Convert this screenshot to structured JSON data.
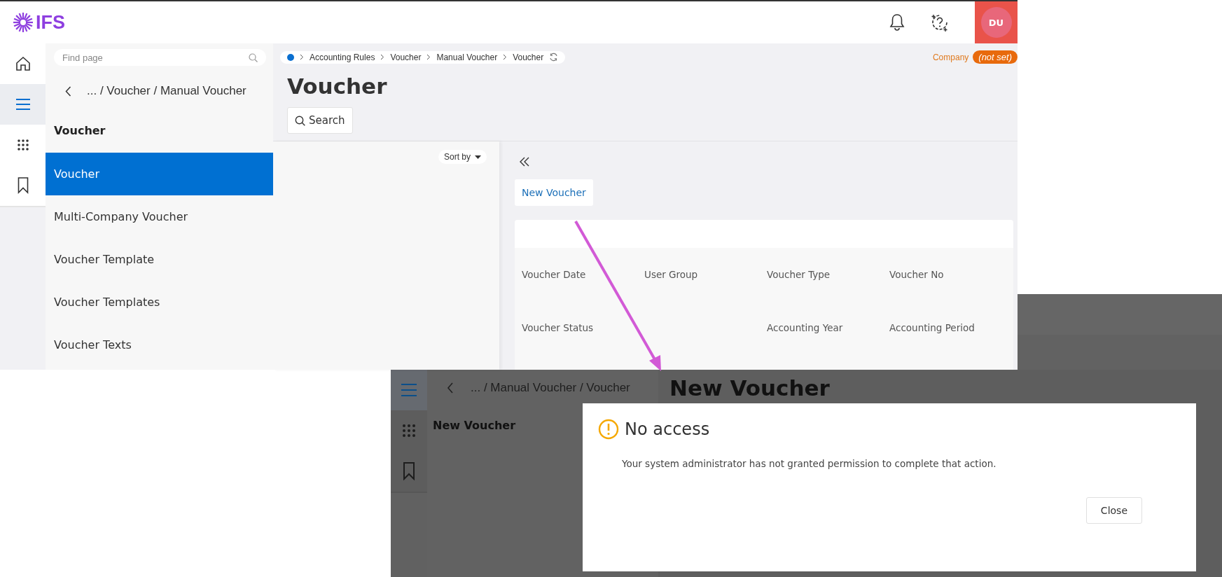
{
  "list_screen": {
    "logo": "IFS",
    "user_initials": "DU",
    "rail": [
      {
        "kind": "home",
        "selected": false
      },
      {
        "kind": "menu",
        "selected": true
      },
      {
        "kind": "apps",
        "selected": false
      },
      {
        "kind": "bookmark",
        "selected": false
      }
    ],
    "find_page": {
      "placeholder": "Find page"
    },
    "nav_back": "... / Voucher / Manual Voucher",
    "nav_heading": "Voucher",
    "nav_items": [
      {
        "label": "Voucher",
        "selected": true
      },
      {
        "label": "Multi-Company Voucher",
        "selected": false
      },
      {
        "label": "Voucher Template",
        "selected": false
      },
      {
        "label": "Voucher Templates",
        "selected": false
      },
      {
        "label": "Voucher Texts",
        "selected": false
      }
    ],
    "breadcrumb": [
      "Accounting Rules",
      "Voucher",
      "Manual Voucher",
      "Voucher"
    ],
    "company_label": "Company",
    "company_value": "(not set)",
    "title": "Voucher",
    "search_button": "Search",
    "sort_by": "Sort by",
    "new_button": "New Voucher",
    "field_rows": [
      [
        {
          "kind": "label",
          "label": "Voucher Date"
        },
        {
          "kind": "label",
          "label": "User Group"
        },
        {
          "kind": "label",
          "label": "Voucher Type"
        },
        {
          "kind": "label",
          "label": "Voucher No"
        }
      ],
      [
        {
          "kind": "label",
          "label": "Voucher Status"
        },
        {
          "kind": "blank"
        },
        {
          "kind": "label",
          "label": "Accounting Year"
        },
        {
          "kind": "label",
          "label": "Accounting Period"
        }
      ]
    ]
  },
  "dialog_screen": {
    "rail": [
      {
        "kind": "menu",
        "selected": true
      },
      {
        "kind": "apps",
        "selected": false
      },
      {
        "kind": "bookmark",
        "selected": false
      }
    ],
    "nav_back": "... / Manual Voucher / Voucher",
    "nav_heading": "New Voucher",
    "title": "New Voucher",
    "dialog": {
      "title": "No access",
      "message": "Your system administrator has not granted permission to complete that action.",
      "buttons": [
        "Close"
      ]
    }
  }
}
